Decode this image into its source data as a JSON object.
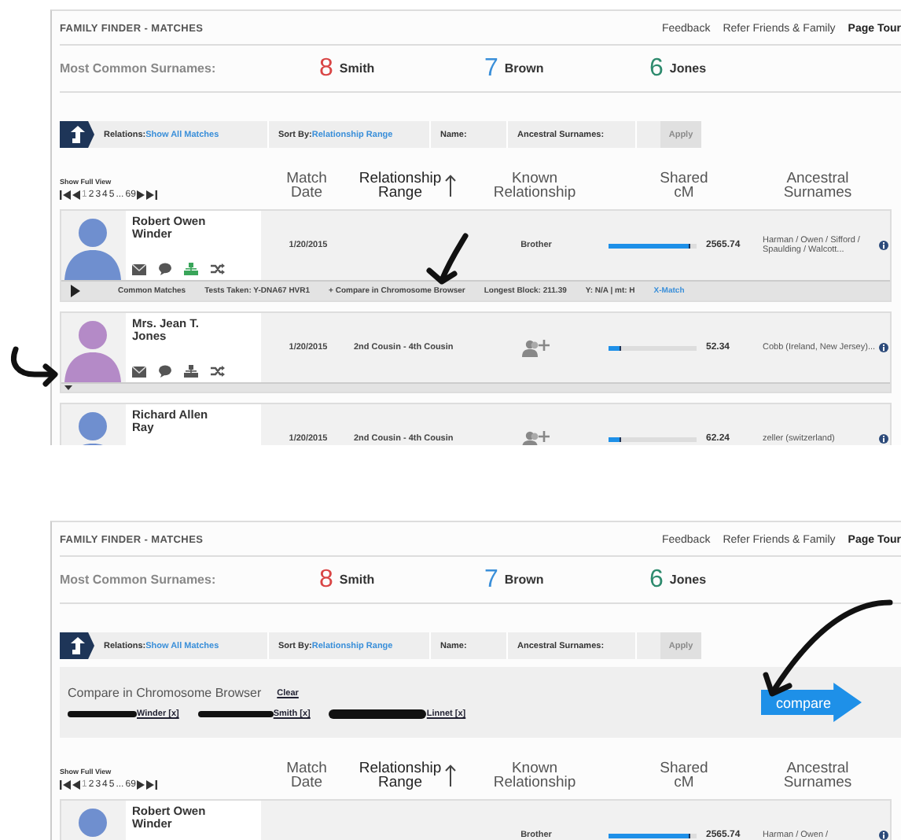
{
  "panels": [
    {
      "header": {
        "title": "FAMILY FINDER - MATCHES",
        "links": [
          {
            "label": "Feedback",
            "emphasized": false
          },
          {
            "label": "Refer Friends & Family",
            "emphasized": false
          },
          {
            "label": "Page Tour",
            "emphasized": true
          }
        ]
      },
      "surnames": {
        "label": "Most Common Surnames:",
        "items": [
          {
            "count": "8",
            "name": "Smith",
            "color": "#d94545"
          },
          {
            "count": "7",
            "name": "Brown",
            "color": "#3a8fd9"
          },
          {
            "count": "6",
            "name": "Jones",
            "color": "#2e8b6e"
          }
        ]
      },
      "filters": [
        {
          "label": "Relations:",
          "value": "Show All Matches"
        },
        {
          "label": "Sort By:",
          "value": "Relationship Range"
        },
        {
          "label": "Name:"
        },
        {
          "label": "Ancestral Surnames:"
        }
      ],
      "apply": {
        "label": "Apply",
        "disabled": true
      },
      "show_full_view": "Show Full View",
      "pager": {
        "pages": [
          {
            "label": "1",
            "selected": true
          },
          {
            "label": "2",
            "selected": false
          },
          {
            "label": "3",
            "selected": false
          },
          {
            "label": "4",
            "selected": false
          },
          {
            "label": "5",
            "selected": false
          },
          {
            "label": "...",
            "selected": false
          },
          {
            "label": "69",
            "selected": false
          }
        ]
      },
      "columns": [
        {
          "label": "Match Date",
          "sorted": false
        },
        {
          "label": "Relationship Range",
          "sorted": true
        },
        {
          "label": "Known Relationship",
          "sorted": false
        },
        {
          "label": "Shared cM",
          "sorted": false
        },
        {
          "label": "Ancestral Surnames",
          "sorted": false
        }
      ],
      "rows": [
        {
          "name": "Robert Owen Winder",
          "color": "#6f8fcf",
          "tree_linked": true,
          "date": "1/20/2015",
          "known_relationship": "Brother",
          "level": 0.92,
          "shared_cm": "2565.74",
          "ancestral_surnames": "Harman / Owen / Sifford / Spaulding / Walcott...",
          "expanded": true,
          "details": {
            "common_matches": "Common Matches",
            "tests": "Tests Taken: Y-DNA67  HVR1",
            "compare": "+ Compare in Chromosome Browser",
            "longest_block": "Longest Block: 211.39",
            "haplogroups": "Y: N/A | mt: H",
            "x_match": "X-Match"
          }
        },
        {
          "name": "Mrs. Jean T. Jones",
          "color": "#b48ac7",
          "tree_linked": false,
          "date": "1/20/2015",
          "relationship_range": "2nd Cousin - 4th Cousin",
          "level": 0.15,
          "shared_cm": "52.34",
          "ancestral_surnames": "Cobb (Ireland, New Jersey)...",
          "expanded": false
        },
        {
          "name": "Richard Allen Ray",
          "color": "#6f8fcf",
          "date": "1/20/2015",
          "relationship_range": "2nd Cousin - 4th Cousin",
          "level": 0.15,
          "shared_cm": "62.24",
          "ancestral_surnames": "zeller (switzerland)"
        }
      ]
    },
    {
      "header": {
        "title": "FAMILY FINDER - MATCHES",
        "links": [
          {
            "label": "Feedback",
            "emphasized": false
          },
          {
            "label": "Refer Friends & Family",
            "emphasized": false
          },
          {
            "label": "Page Tour",
            "emphasized": true
          }
        ]
      },
      "surnames": {
        "label": "Most Common Surnames:",
        "items": [
          {
            "count": "8",
            "name": "Smith",
            "color": "#d94545"
          },
          {
            "count": "7",
            "name": "Brown",
            "color": "#3a8fd9"
          },
          {
            "count": "6",
            "name": "Jones",
            "color": "#2e8b6e"
          }
        ]
      },
      "filters": [
        {
          "label": "Relations:",
          "value": "Show All Matches"
        },
        {
          "label": "Sort By:",
          "value": "Relationship Range"
        },
        {
          "label": "Name:"
        },
        {
          "label": "Ancestral Surnames:"
        }
      ],
      "apply": {
        "label": "Apply",
        "disabled": true
      },
      "compare_box": {
        "title": "Compare in Chromosome Browser",
        "clear": "Clear",
        "chips": [
          "Winder [x]",
          "Smith [x]",
          "Linnet [x]"
        ],
        "button": "compare"
      },
      "show_full_view": "Show Full View",
      "pager": {
        "pages": [
          {
            "label": "1",
            "selected": true
          },
          {
            "label": "2",
            "selected": false
          },
          {
            "label": "3",
            "selected": false
          },
          {
            "label": "4",
            "selected": false
          },
          {
            "label": "5",
            "selected": false
          },
          {
            "label": "...",
            "selected": false
          },
          {
            "label": "69",
            "selected": false
          }
        ]
      },
      "columns": [
        {
          "label": "Match Date",
          "sorted": false
        },
        {
          "label": "Relationship Range",
          "sorted": true
        },
        {
          "label": "Known Relationship",
          "sorted": false
        },
        {
          "label": "Shared cM",
          "sorted": false
        },
        {
          "label": "Ancestral Surnames",
          "sorted": false
        }
      ],
      "rows": [
        {
          "name": "Robert Owen Winder",
          "color": "#6f8fcf",
          "known_relationship": "Brother",
          "level": 0.92,
          "shared_cm": "2565.74",
          "ancestral_surnames": "Harman / Owen /"
        }
      ]
    }
  ]
}
